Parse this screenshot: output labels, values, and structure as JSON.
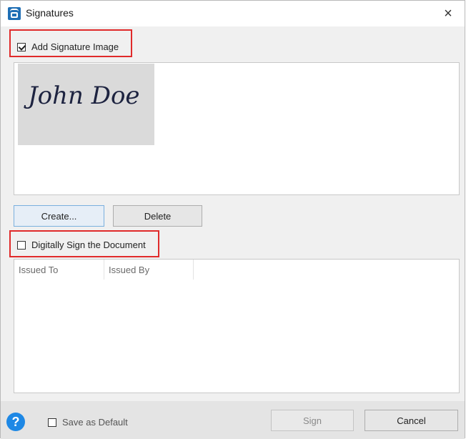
{
  "window": {
    "title": "Signatures",
    "close_glyph": "×"
  },
  "icons": {
    "app": "signature-app-icon",
    "close": "close-icon",
    "help": "help-icon"
  },
  "colors": {
    "highlight": "#e02a2a",
    "accent": "#1e88e5"
  },
  "signature_section": {
    "checkbox_label": "Add Signature Image",
    "checked": true,
    "signature_text": "John Doe",
    "create_label": "Create...",
    "delete_label": "Delete"
  },
  "digital_section": {
    "checkbox_label": "Digitally Sign the Document",
    "checked": false,
    "columns": [
      "Issued To",
      "Issued By"
    ]
  },
  "footer": {
    "help_glyph": "?",
    "save_default_label": "Save as Default",
    "save_default_checked": false,
    "sign_label": "Sign",
    "cancel_label": "Cancel"
  }
}
